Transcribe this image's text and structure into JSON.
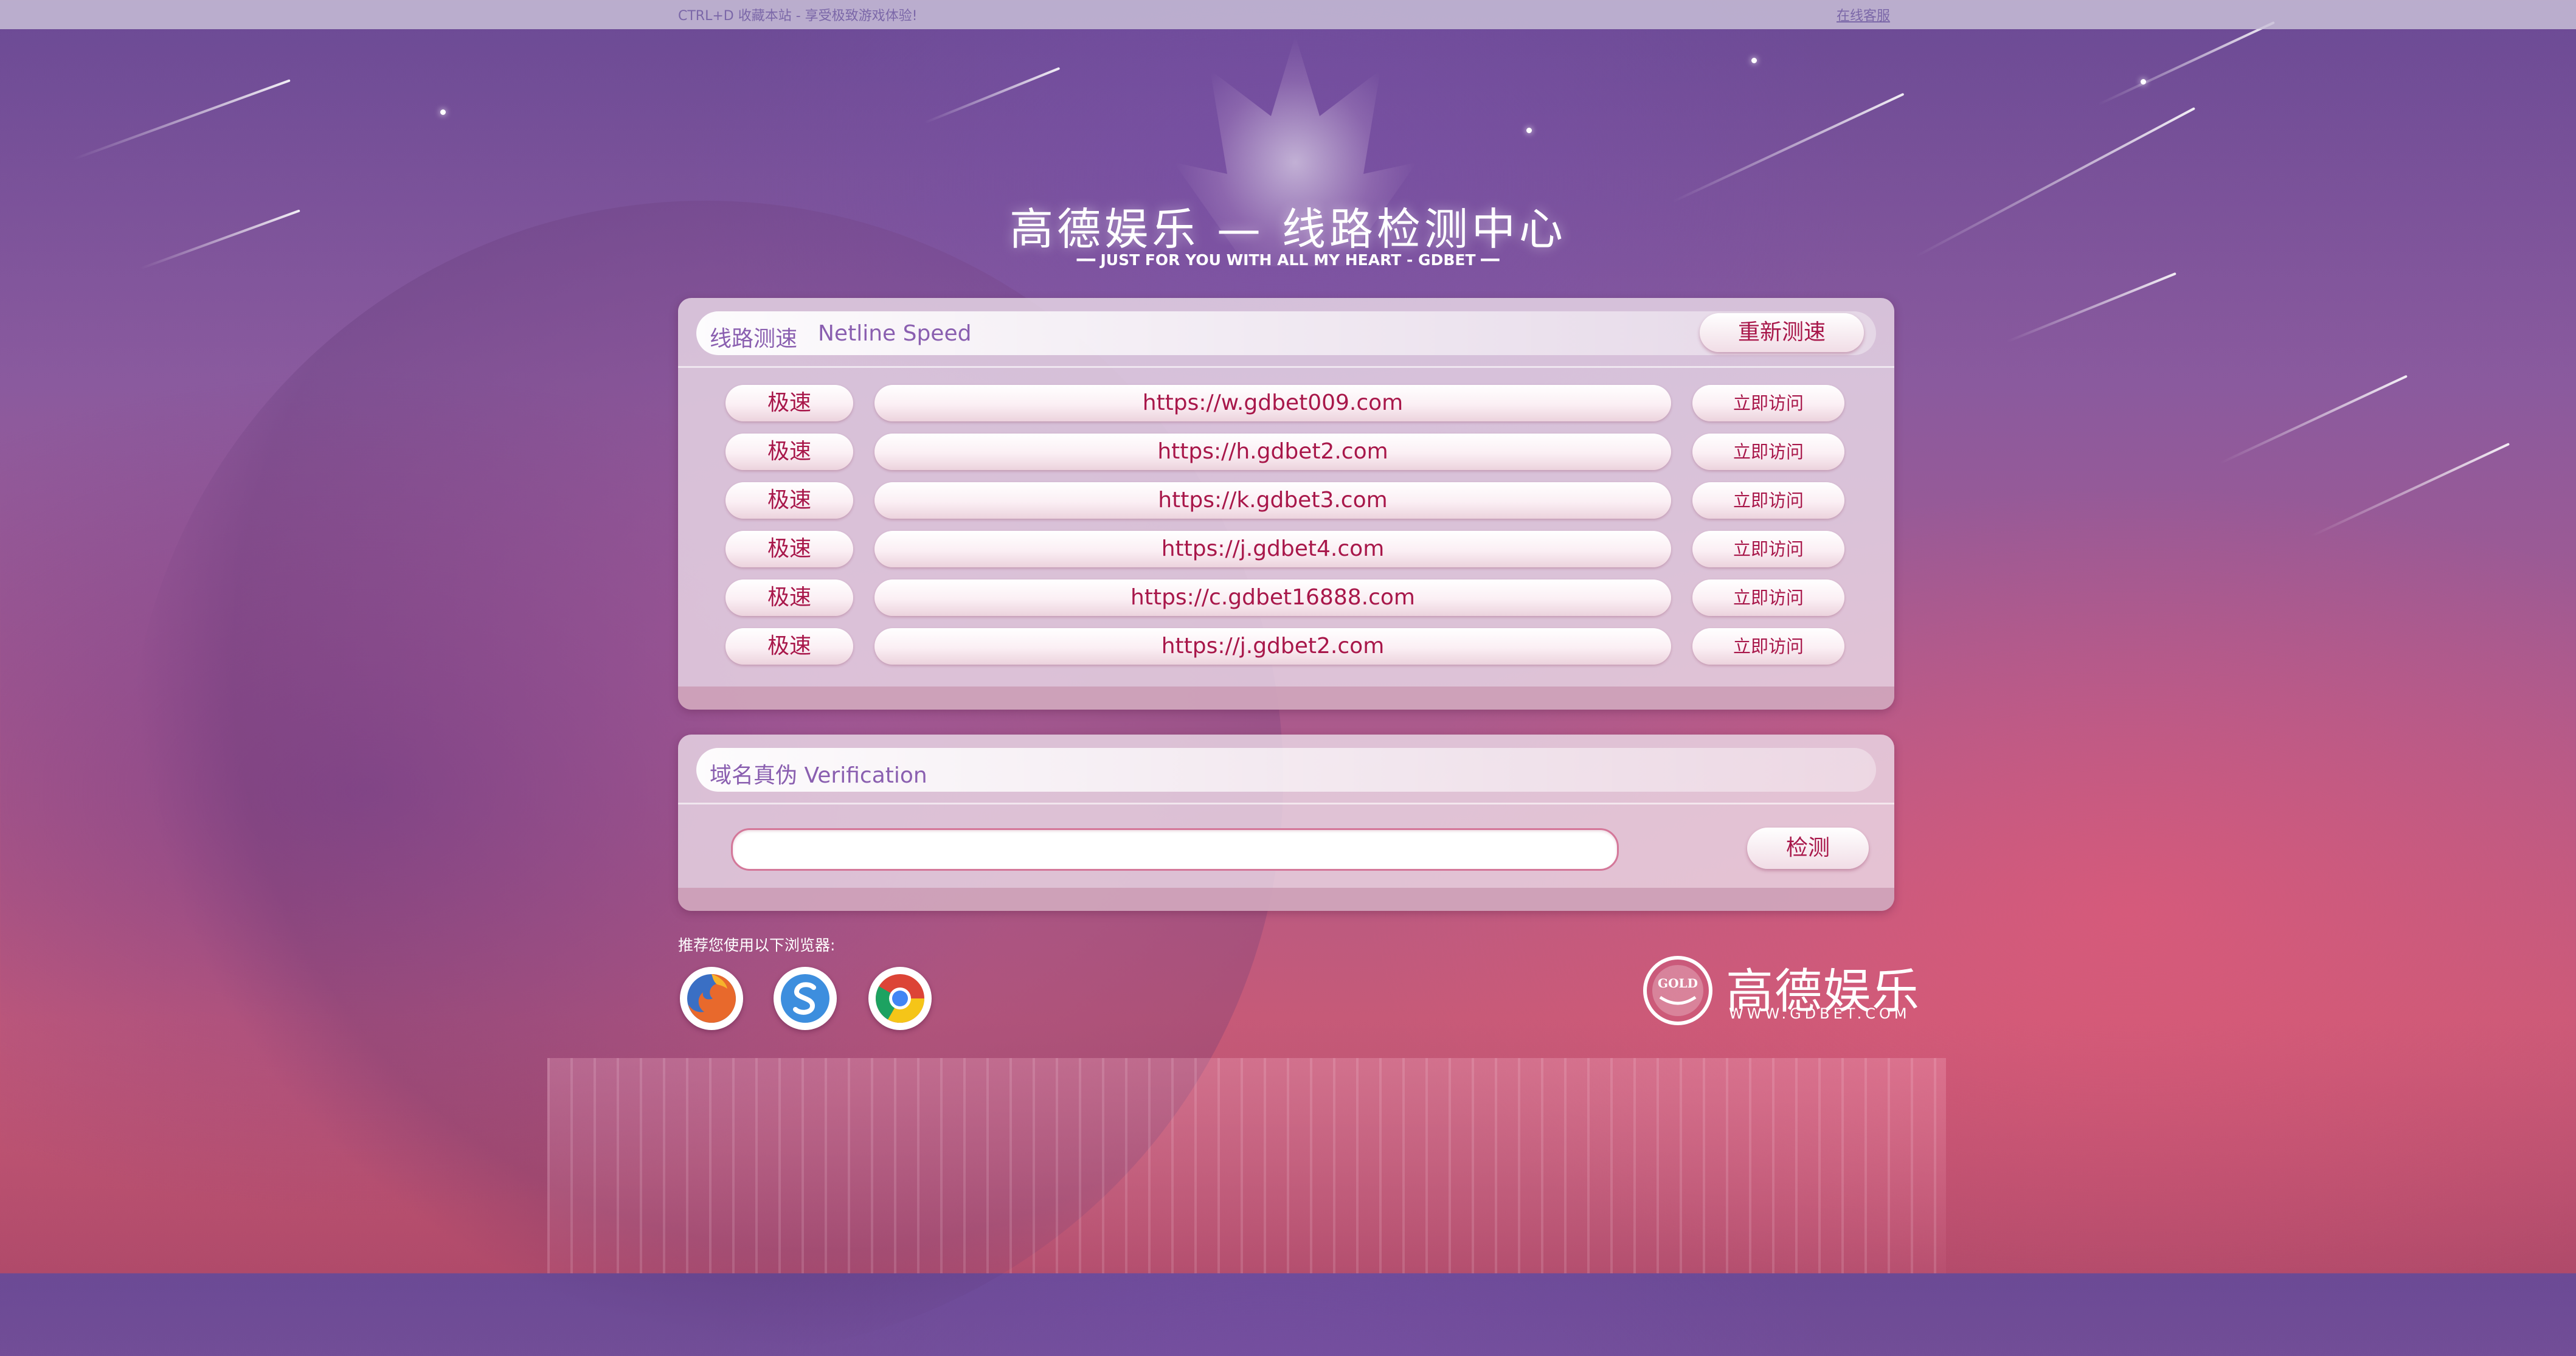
{
  "topbar": {
    "tip": "CTRL+D 收藏本站 - 享受极致游戏体验!",
    "service": "在线客服"
  },
  "header": {
    "title": "高德娱乐 — 线路检测中心",
    "subtitle": "━━ JUST FOR YOU WITH ALL MY HEART - GDBET ━━"
  },
  "speed_panel": {
    "label": "线路测速",
    "label_en": "Netline Speed",
    "retest_label": "重新测速",
    "rows": [
      {
        "speed": "极速",
        "url": "https://w.gdbet009.com",
        "visit": "立即访问"
      },
      {
        "speed": "极速",
        "url": "https://h.gdbet2.com",
        "visit": "立即访问"
      },
      {
        "speed": "极速",
        "url": "https://k.gdbet3.com",
        "visit": "立即访问"
      },
      {
        "speed": "极速",
        "url": "https://j.gdbet4.com",
        "visit": "立即访问"
      },
      {
        "speed": "极速",
        "url": "https://c.gdbet16888.com",
        "visit": "立即访问"
      },
      {
        "speed": "极速",
        "url": "https://j.gdbet2.com",
        "visit": "立即访问"
      }
    ]
  },
  "verify_panel": {
    "label": "域名真伪 Verification",
    "input_value": "",
    "check_label": "检测"
  },
  "browsers": {
    "tip": "推荐您使用以下浏览器:",
    "items": [
      {
        "icon": "firefox-icon"
      },
      {
        "icon": "safari-icon"
      },
      {
        "icon": "chrome-icon"
      }
    ]
  },
  "brand": {
    "seal_text": "GOLD",
    "name": "高德娱乐",
    "domain": "WWW.GDBET.COM"
  },
  "colors": {
    "accent": "#a8174a",
    "label": "#8a5fb0",
    "topbar_text": "#7b67a8"
  }
}
